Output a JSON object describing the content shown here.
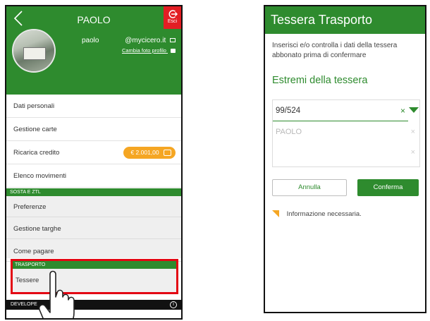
{
  "left_screen": {
    "header": {
      "title": "PAOLO",
      "exit_label": "Esci",
      "username": "paolo",
      "email": "@mycicero.it",
      "change_photo": "Cambia foto profilo"
    },
    "menu": {
      "personal_data": "Dati personali",
      "card_management": "Gestione carte",
      "top_up": "Ricarica credito",
      "credit_amount": "€ 2.001,00",
      "movements": "Elenco movimenti"
    },
    "sosta_section": {
      "title": "SOSTA E ZTL",
      "items": [
        "Preferenze",
        "Gestione targhe",
        "Come pagare"
      ]
    },
    "trasporto_section": {
      "title": "TRASPORTO",
      "item": "Tessere"
    },
    "developer_bar": {
      "label": "DEVELOPE",
      "info_glyph": "i"
    },
    "colors": {
      "brand_green": "#2e8b2e",
      "exit_red": "#e31e24",
      "highlight_red": "#e30613",
      "credit_orange": "#f5a623"
    }
  },
  "right_screen": {
    "header": {
      "title": "Tessera Trasporto"
    },
    "intro": "Inserisci e/o controlla i dati della tessera abbonato prima di confermare",
    "section_title": "Estremi della tessera",
    "fields": {
      "card_number": "99/524",
      "holder_name_placeholder": "PAOLO",
      "clear_glyph": "×"
    },
    "buttons": {
      "cancel": "Annulla",
      "confirm": "Conferma"
    },
    "required_note": "Informazione necessaria."
  }
}
